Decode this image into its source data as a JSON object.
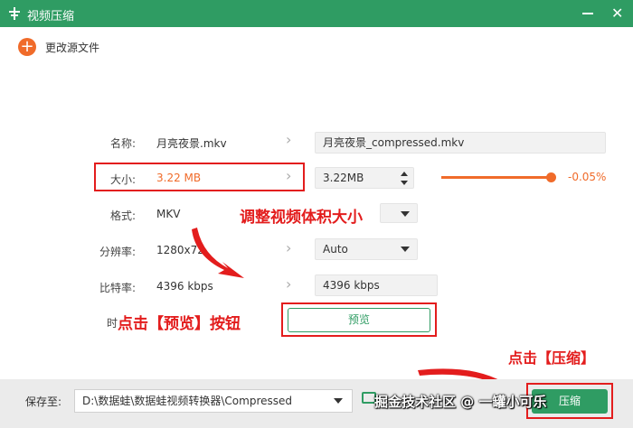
{
  "window": {
    "title": "视频压缩",
    "close_glyph": "✕"
  },
  "toolbar": {
    "change_source_label": "更改源文件",
    "plus_glyph": "+"
  },
  "form": {
    "name": {
      "label": "名称:",
      "source": "月亮夜景.mkv",
      "output": "月亮夜景_compressed.mkv"
    },
    "size": {
      "label": "大小:",
      "source": "3.22 MB",
      "output": "3.22MB",
      "percent": "-0.05%",
      "slider_fraction": 0.95
    },
    "format": {
      "label": "格式:",
      "source": "MKV",
      "output": ""
    },
    "resolution": {
      "label": "分辨率:",
      "source": "1280x72",
      "output": "Auto"
    },
    "bitrate": {
      "label": "比特率:",
      "source": "4396 kbps",
      "output": "4396 kbps"
    },
    "preview": {
      "label_fragment": "时",
      "button": "预览"
    }
  },
  "annotations": {
    "adjust_size": "调整视频体积大小",
    "click_preview": "点击【预览】按钮",
    "click_compress": "点击【压缩】"
  },
  "bottom": {
    "save_label": "保存至:",
    "save_path": "D:\\数据蛙\\数据蛙视频转换器\\Compressed",
    "compress_button": "压缩"
  },
  "watermark": "掘金技术社区 @ 一罐小可乐",
  "colors": {
    "accent": "#2f9c63",
    "orange": "#f06b2a",
    "annotation": "#e31d1d"
  }
}
